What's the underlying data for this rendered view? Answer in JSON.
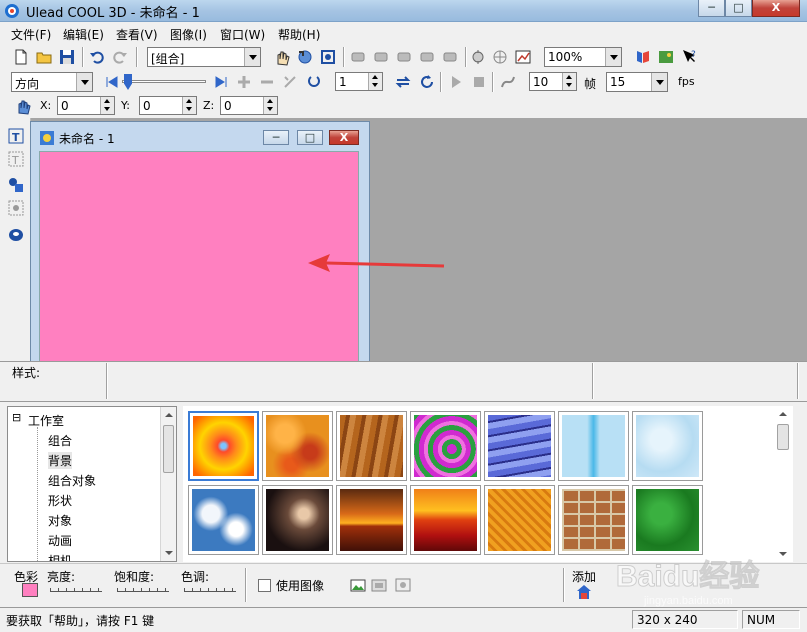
{
  "window": {
    "title": "Ulead COOL 3D - 未命名 - 1",
    "minimize_label": "─",
    "maximize_label": "□",
    "close_label": "X"
  },
  "menu": [
    "文件(F)",
    "编辑(E)",
    "查看(V)",
    "图像(I)",
    "窗口(W)",
    "帮助(H)"
  ],
  "toolbar1": {
    "object_select": "[组合]",
    "zoom": "100%"
  },
  "toolbar2": {
    "mode_select": "方向",
    "step_value": "1",
    "frame_value": "10",
    "frame_label": "帧",
    "fps_value": "15",
    "fps_label": "fps"
  },
  "toolbar3": {
    "x_label": "X:",
    "x_value": "0",
    "y_label": "Y:",
    "y_value": "0",
    "z_label": "Z:",
    "z_value": "0"
  },
  "document": {
    "title": "未命名 - 1",
    "canvas_color": "#ff80c0"
  },
  "style_panel": {
    "label": "样式:"
  },
  "tree": {
    "root": "工作室",
    "root_toggle": "⊟",
    "items": [
      "组合",
      "背景",
      "组合对象",
      "形状",
      "对象",
      "动画",
      "相机"
    ],
    "selected_index": 1
  },
  "thumbnails": [
    {
      "name": "radial-sunburst",
      "selected": true
    },
    {
      "name": "orange-mottled"
    },
    {
      "name": "wood-grain"
    },
    {
      "name": "green-purple-swirl"
    },
    {
      "name": "blue-water-ripple"
    },
    {
      "name": "ice-blue-texture"
    },
    {
      "name": "frost-light-blue"
    },
    {
      "name": "cloudy-sky"
    },
    {
      "name": "dark-storm-clouds"
    },
    {
      "name": "sunset-sea-1"
    },
    {
      "name": "sunset-sea-2"
    },
    {
      "name": "orange-weave"
    },
    {
      "name": "brick-wall"
    },
    {
      "name": "green-leather"
    }
  ],
  "colorbar": {
    "color_label": "色彩",
    "color_value": "#ff80c0",
    "brightness_label": "亮度:",
    "saturation_label": "饱和度:",
    "hue_label": "色调:",
    "use_image_label": "使用图像",
    "add_label": "添加"
  },
  "statusbar": {
    "help_text": "要获取「帮助」，请按 F1 键",
    "size": "320 x 240",
    "num": "NUM"
  },
  "watermark": {
    "brand": "Baidu经验",
    "url": "jingyan.baidu.com"
  }
}
